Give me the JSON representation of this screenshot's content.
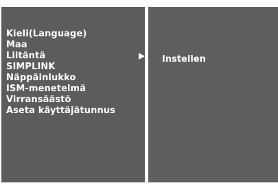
{
  "menu": {
    "items": [
      {
        "label": "Kieli(Language)"
      },
      {
        "label": "Maa"
      },
      {
        "label": "Liitäntä",
        "active": true
      },
      {
        "label": "SIMPLINK"
      },
      {
        "label": "Näppäinlukko"
      },
      {
        "label": "ISM-menetelmä"
      },
      {
        "label": "Virransäästö"
      },
      {
        "label": "Aseta käyttäjätunnus"
      }
    ]
  },
  "submenu": {
    "items": [
      {
        "label": "Instellen"
      }
    ]
  },
  "icons": {
    "selected_arrow": "arrow-right-icon"
  },
  "colors": {
    "panel_left": "#5c5c5c",
    "panel_right": "#5f5f5f",
    "text": "#ffffff",
    "divider": "#ffffff"
  }
}
